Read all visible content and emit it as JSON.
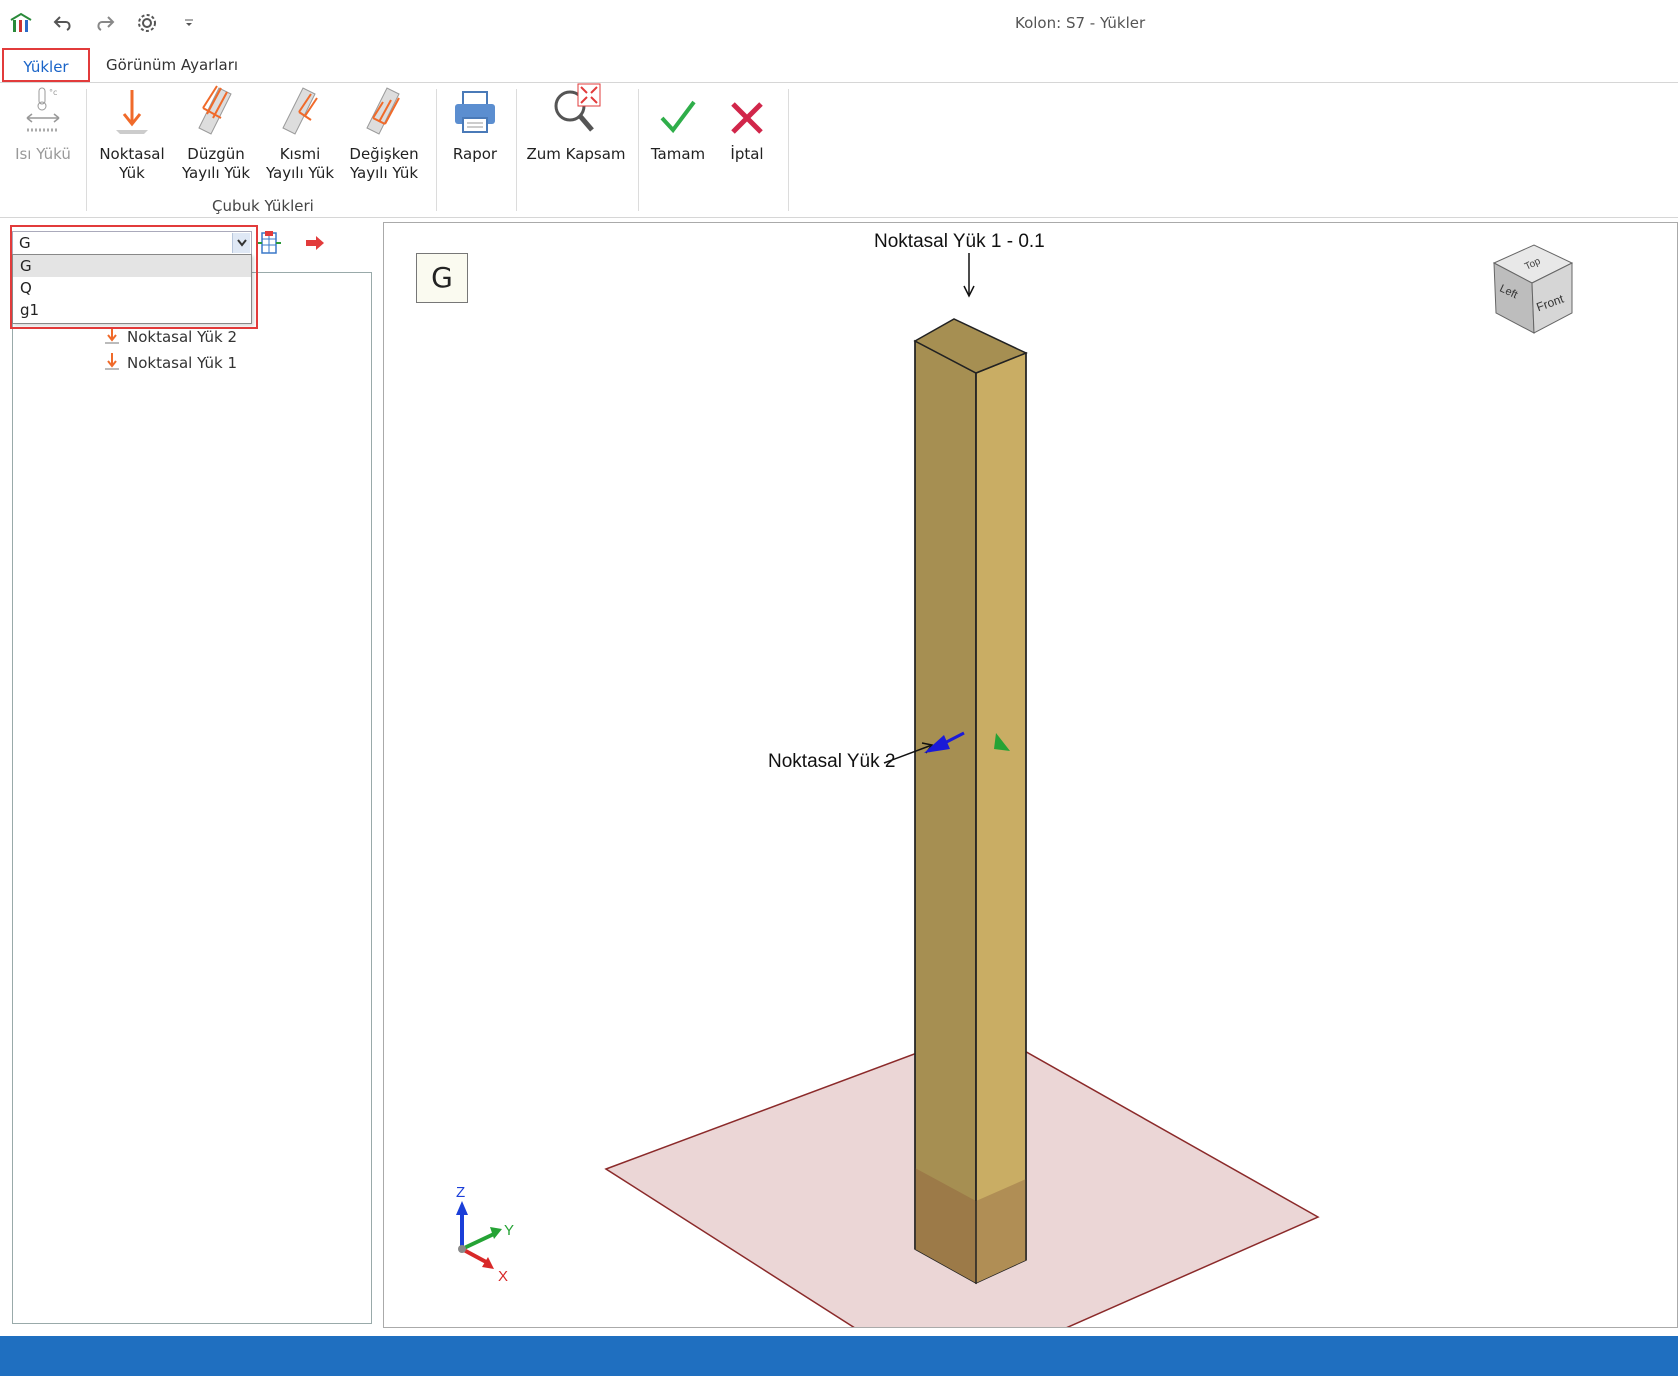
{
  "window": {
    "title": "Kolon: S7 - Yükler"
  },
  "tabs": {
    "loads": "Yükler",
    "view_settings": "Görünüm Ayarları"
  },
  "ribbon": {
    "heat_load": "Isı Yükü",
    "point_load_line1": "Noktasal",
    "point_load_line2": "Yük",
    "uniform_load_line1": "Düzgün",
    "uniform_load_line2": "Yayılı Yük",
    "partial_load_line1": "Kısmi",
    "partial_load_line2": "Yayılı Yük",
    "variable_load_line1": "Değişken",
    "variable_load_line2": "Yayılı Yük",
    "group_label": "Çubuk Yükleri",
    "report": "Rapor",
    "zoom_extents": "Zum Kapsam",
    "ok": "Tamam",
    "cancel": "İptal"
  },
  "left_panel": {
    "load_case_value": "G",
    "dropdown_options": [
      "G",
      "Q",
      "g1"
    ],
    "tree_items": [
      "Noktasal Yük 2",
      "Noktasal Yük 1"
    ]
  },
  "viewport": {
    "case_label": "G",
    "load1_label": "Noktasal Yük 1 - 0.1",
    "load2_label": "Noktasal Yük 2",
    "viewcube": {
      "top": "Top",
      "left": "Left",
      "front": "Front"
    },
    "axes": {
      "x": "X",
      "y": "Y",
      "z": "Z"
    }
  },
  "colors": {
    "accent": "#1a64c8",
    "highlight": "#e23b3b",
    "status_bar": "#1f6fc0",
    "column": "#a68f52",
    "slab": "#ebd6d6"
  }
}
